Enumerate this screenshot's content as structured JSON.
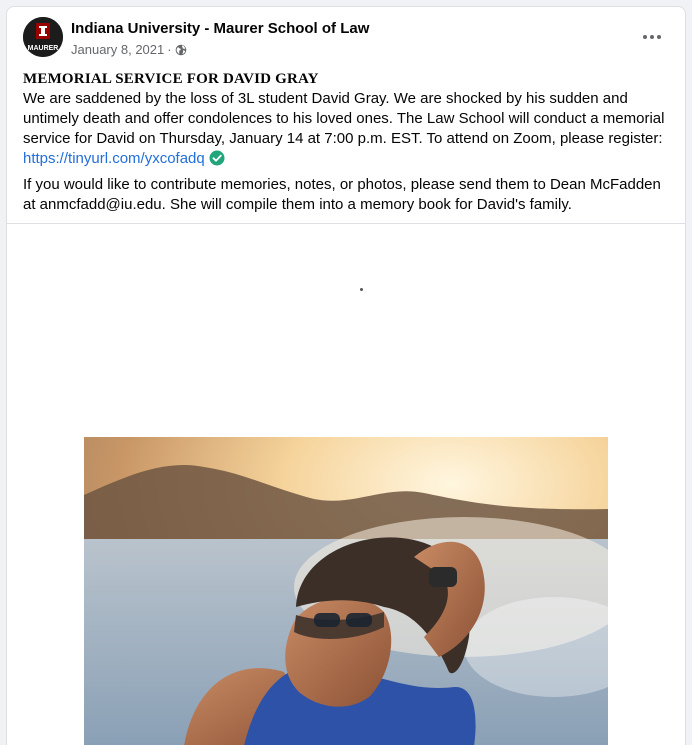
{
  "post": {
    "page_name": "Indiana University - Maurer School of Law",
    "date": "January 8, 2021",
    "separator": "·",
    "avatar_text": "MAURER",
    "title": "MEMORIAL SERVICE FOR DAVID GRAY",
    "paragraph1": "We are saddened by the loss of 3L student David Gray. We are shocked by his sudden and untimely death and offer condolences to his loved ones. The Law School will conduct a memorial service for David on Thursday, January 14 at 7:00 p.m. EST. To attend on Zoom, please register: ",
    "link": "https://tinyurl.com/yxcofadq",
    "paragraph2": "If you would like to contribute memories, notes, or photos, please send them to Dean McFadden at anmcfadd@iu.edu. She will compile them into a memory book for David's family."
  },
  "icons": {
    "globe": "globe-icon",
    "more": "more-options-icon",
    "check": "check-circle-icon"
  },
  "colors": {
    "link": "#216fdb",
    "check": "#20a67a",
    "secondary_text": "#65676b",
    "brand_red": "#990000"
  }
}
